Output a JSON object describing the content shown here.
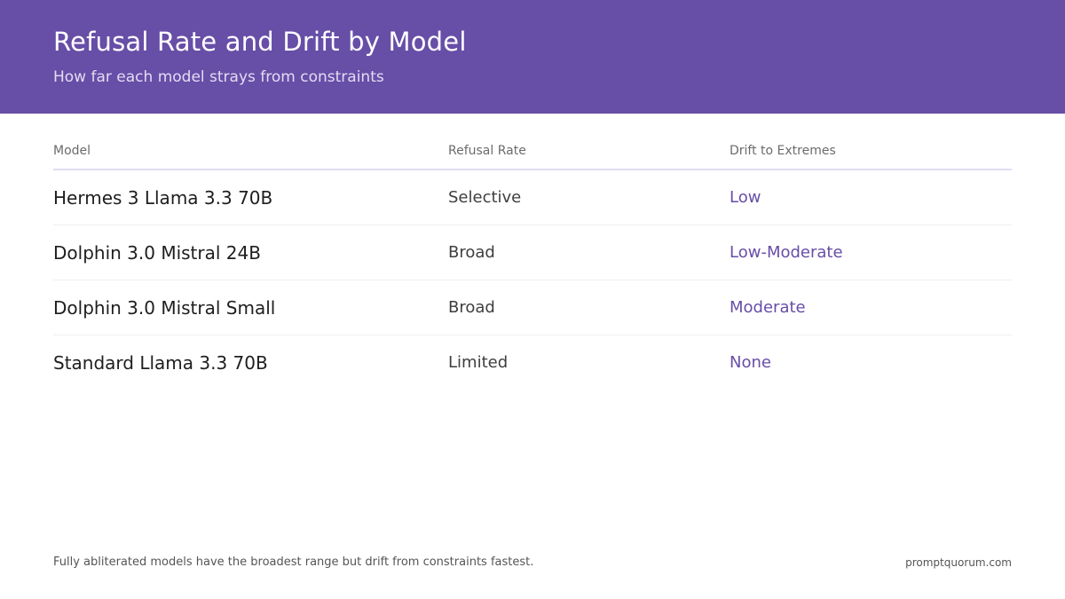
{
  "header": {
    "title": "Refusal Rate and Drift by Model",
    "subtitle": "How far each model strays from constraints",
    "background_color": "#674ea7"
  },
  "table": {
    "columns": [
      "Model",
      "Refusal Rate",
      "Drift to Extremes"
    ],
    "rows": [
      {
        "model": "Hermes 3 Llama 3.3 70B",
        "refusal_rate": "Selective",
        "drift": "Low"
      },
      {
        "model": "Dolphin 3.0 Mistral 24B",
        "refusal_rate": "Broad",
        "drift": "Low-Moderate"
      },
      {
        "model": "Dolphin 3.0 Mistral Small",
        "refusal_rate": "Broad",
        "drift": "Moderate"
      },
      {
        "model": "Standard Llama 3.3 70B",
        "refusal_rate": "Limited",
        "drift": "None"
      }
    ],
    "accent_color": "#674ea7"
  },
  "footer": {
    "note": "Fully abliterated models have the broadest range but drift from constraints fastest.",
    "brand": "promptquorum.com"
  }
}
